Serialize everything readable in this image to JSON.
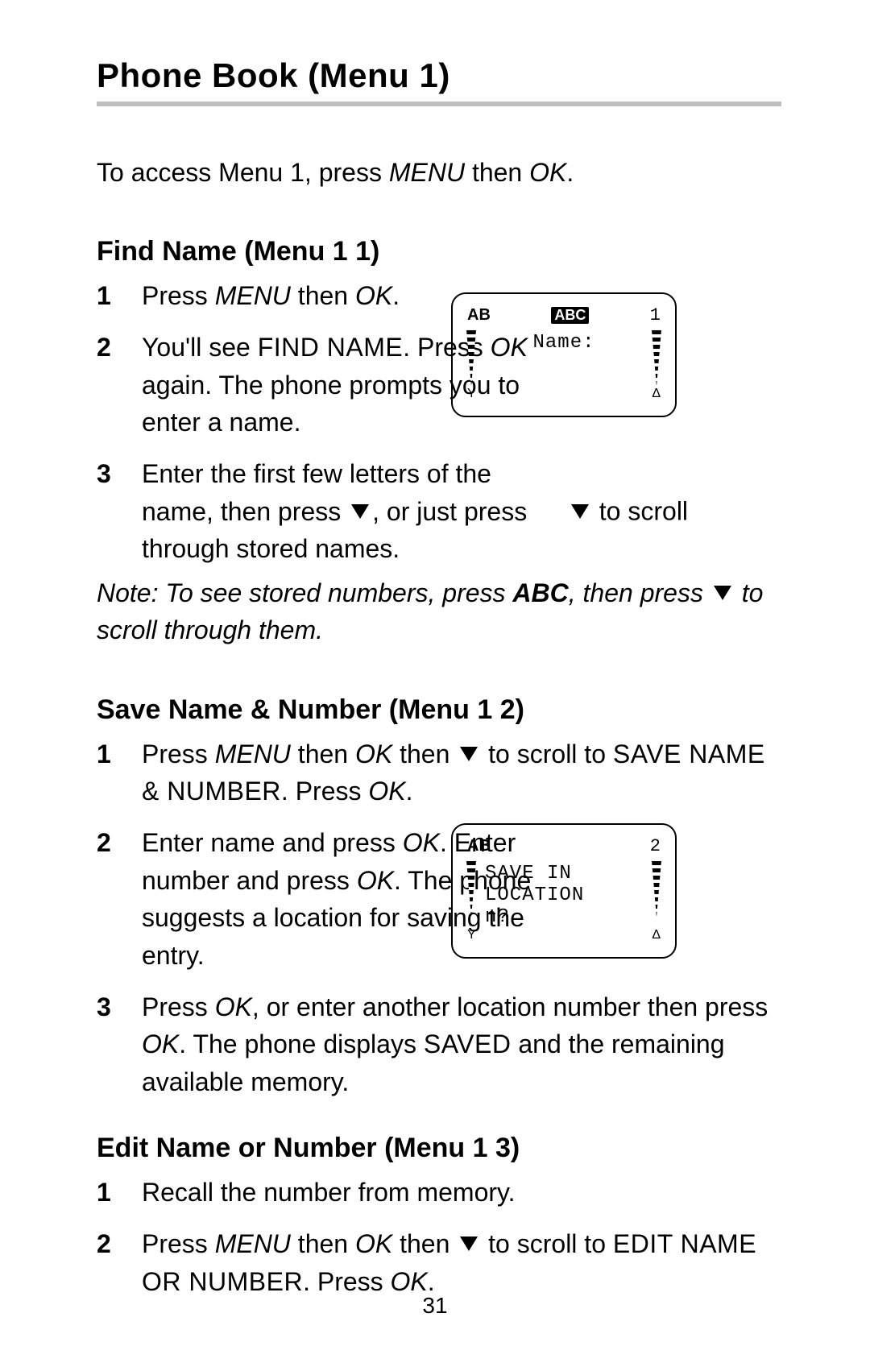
{
  "title": "Phone Book (Menu 1)",
  "intro_a": "To access Menu 1, press ",
  "intro_menu": "MENU",
  "intro_b": " then ",
  "intro_ok": "OK",
  "intro_c": ".",
  "page_number": "31",
  "findname": {
    "heading": "Find Name (Menu 1 1)",
    "s1a": "Press ",
    "s1_menu": "MENU",
    "s1b": " then ",
    "s1_ok": "OK",
    "s1c": ".",
    "s2a": "You'll see ",
    "s2_find": "FIND NAME",
    "s2b": ".  Press ",
    "s2_ok": "OK",
    "s2c": " again. The phone prompts you to enter a name.",
    "s3a": "Enter the first few letters of the name, then press ",
    "s3b": ", or just press ",
    "s3c": " to scroll through stored names.",
    "note_a": "Note: To see stored numbers, press ",
    "note_abc": "ABC",
    "note_b": ", then press ",
    "note_c": " to scroll through them.",
    "screen": {
      "ab": "AB",
      "abc": "ABC",
      "num": "1",
      "text": "Name:",
      "bl": "Y",
      "br": "Δ"
    }
  },
  "savename": {
    "heading": "Save Name & Number (Menu 1 2)",
    "s1a": "Press ",
    "s1_menu": "MENU",
    "s1b": " then ",
    "s1_ok": "OK",
    "s1c": " then ",
    "s1d": " to scroll to ",
    "s1_save": "SAVE NAME & NUMBER",
    "s1e": ". Press ",
    "s1_ok2": "OK",
    "s1f": ".",
    "s2a": "Enter name and press ",
    "s2_ok1": "OK",
    "s2b": ". Enter number and press ",
    "s2_ok2": "OK",
    "s2c": ". The phone suggests a location for saving the entry.",
    "s3a": "Press ",
    "s3_ok1": "OK",
    "s3b": ", or enter another location number then press ",
    "s3_ok2": "OK",
    "s3c": ". The phone displays ",
    "s3_saved": "SAVED",
    "s3d": " and the remaining available memory.",
    "screen": {
      "ab": "AB",
      "num": "2",
      "line1": "SAVE IN",
      "line2": "LOCATION",
      "line3": "n?",
      "bl": "Y",
      "br": "Δ"
    }
  },
  "editname": {
    "heading": "Edit Name or Number (Menu 1 3)",
    "s1": "Recall the number from memory.",
    "s2a": "Press ",
    "s2_menu": "MENU",
    "s2b": " then ",
    "s2_ok": "OK",
    "s2c": " then ",
    "s2d": " to scroll to ",
    "s2_edit": "EDIT NAME OR NUMBER",
    "s2e": ". Press ",
    "s2_ok2": "OK",
    "s2f": "."
  }
}
